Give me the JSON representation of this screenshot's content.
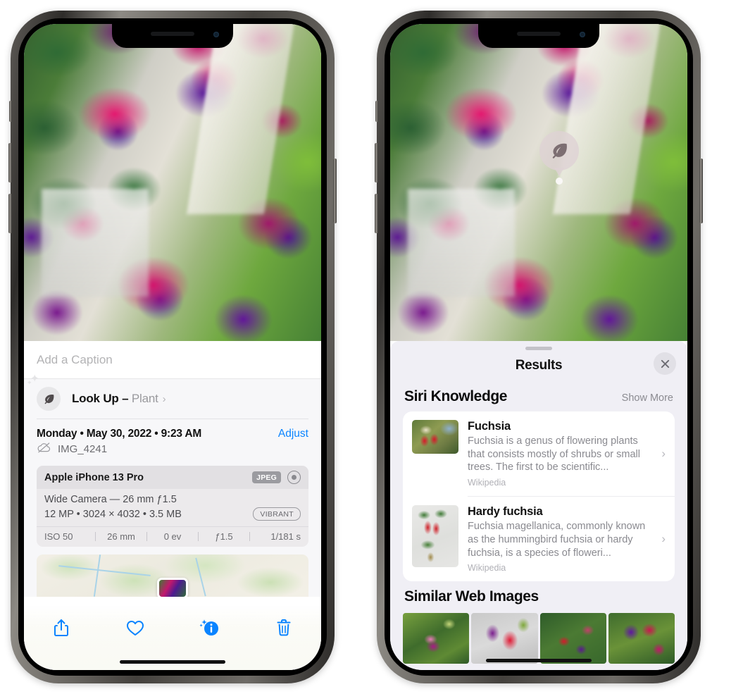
{
  "left_phone": {
    "caption_placeholder": "Add a Caption",
    "lookup": {
      "icon": "leaf-icon",
      "label": "Look Up –",
      "subject": "Plant",
      "chevron": "›"
    },
    "datetime": "Monday • May 30, 2022 • 9:23 AM",
    "adjust_label": "Adjust",
    "cloud_icon": "cloud-slash-icon",
    "filename": "IMG_4241",
    "exif": {
      "model": "Apple iPhone 13 Pro",
      "format_badge": "JPEG",
      "raw_icon": "aperture-icon",
      "lens": "Wide Camera — 26 mm ƒ1.5",
      "size_line": "12 MP • 3024 × 4032 • 3.5 MB",
      "style_badge": "VIBRANT",
      "stats": [
        "ISO 50",
        "26 mm",
        "0 ev",
        "ƒ1.5",
        "1/181 s"
      ]
    },
    "toolbar": [
      {
        "name": "share-icon",
        "label": "Share"
      },
      {
        "name": "heart-icon",
        "label": "Favorite"
      },
      {
        "name": "info-sparkle-icon",
        "label": "Info"
      },
      {
        "name": "trash-icon",
        "label": "Delete"
      }
    ]
  },
  "right_phone": {
    "visual_lookup_badge": {
      "icon": "leaf-icon"
    },
    "results": {
      "title": "Results",
      "close_icon": "close-icon",
      "section_title": "Siri Knowledge",
      "show_more": "Show More",
      "cards": [
        {
          "title": "Fuchsia",
          "description": "Fuchsia is a genus of flowering plants that consists mostly of shrubs or small trees. The first to be scientific...",
          "source": "Wikipedia",
          "chevron": "›"
        },
        {
          "title": "Hardy fuchsia",
          "description": "Fuchsia magellanica, commonly known as the hummingbird fuchsia or hardy fuchsia, is a species of floweri...",
          "source": "Wikipedia",
          "chevron": "›"
        }
      ],
      "web_section_title": "Similar Web Images",
      "web_images": [
        {
          "name": "web-thumb-1"
        },
        {
          "name": "web-thumb-2"
        },
        {
          "name": "web-thumb-3"
        },
        {
          "name": "web-thumb-4"
        }
      ]
    }
  },
  "colors": {
    "accent_blue": "#0a84ff",
    "sheet_bg": "#f0eff5",
    "card_bg": "#ffffff",
    "secondary_text": "#8a8a90"
  }
}
